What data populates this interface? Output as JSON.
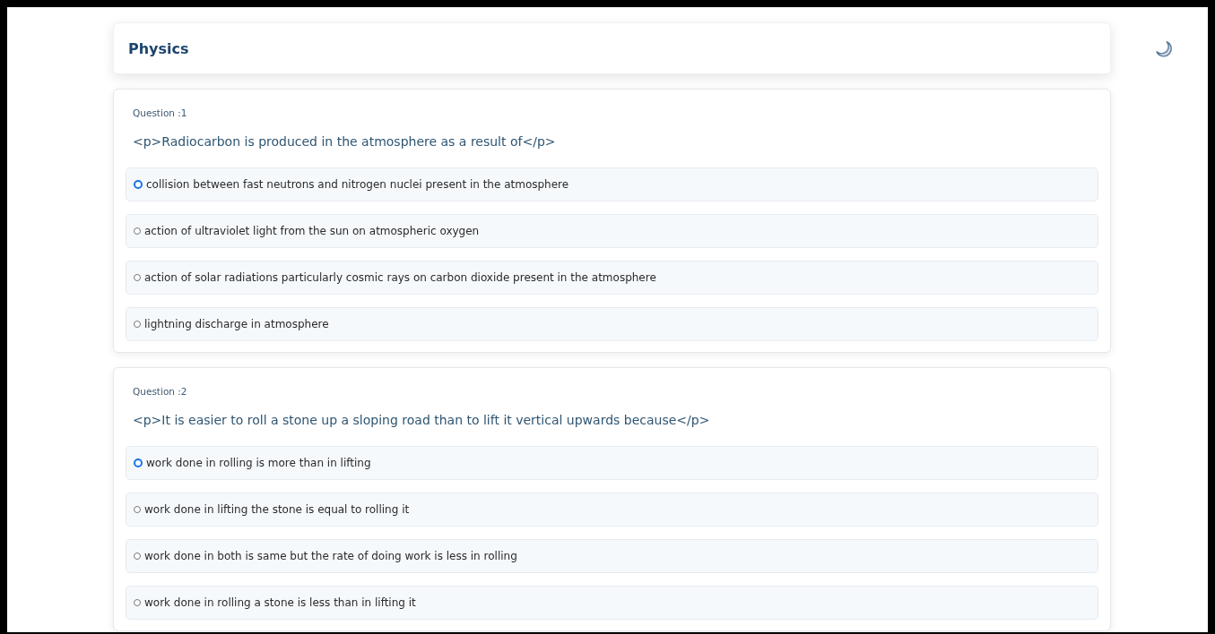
{
  "header": {
    "title": "Physics"
  },
  "questions": [
    {
      "label": "Question :1",
      "text": "<p>Radiocarbon is produced in the atmosphere as a result of</p>",
      "options": [
        {
          "text": "collision between fast neutrons and nitrogen nuclei present in the atmosphere",
          "selected": true
        },
        {
          "text": "action of ultraviolet light from the sun on atmospheric oxygen",
          "selected": false
        },
        {
          "text": "action of solar radiations particularly cosmic rays on carbon dioxide present in the atmosphere",
          "selected": false
        },
        {
          "text": "lightning discharge in atmosphere",
          "selected": false
        }
      ]
    },
    {
      "label": "Question :2",
      "text": "<p>It is easier to roll a stone up a sloping road than to lift it vertical upwards because</p>",
      "options": [
        {
          "text": "work done in rolling is more than in lifting",
          "selected": true
        },
        {
          "text": "work done in lifting the stone is equal to rolling it",
          "selected": false
        },
        {
          "text": "work done in both is same but the rate of doing work is less in rolling",
          "selected": false
        },
        {
          "text": "work done in rolling a stone is less than in lifting it",
          "selected": false
        }
      ]
    }
  ]
}
